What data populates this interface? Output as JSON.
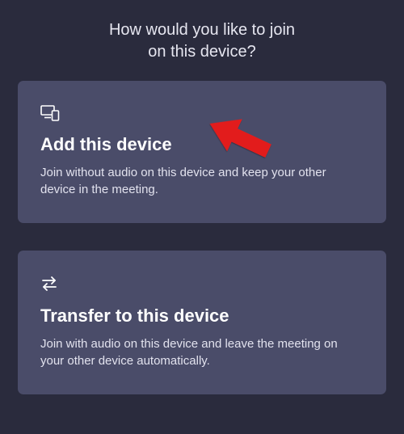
{
  "header": {
    "line1": "How would you like to join",
    "line2": "on this device?"
  },
  "cards": [
    {
      "icon": "devices-icon",
      "title": "Add this device",
      "desc": "Join without audio on this device and keep your other device in the meeting."
    },
    {
      "icon": "transfer-icon",
      "title": "Transfer to this device",
      "desc": "Join with audio on this device and leave the meeting on your other device automatically."
    }
  ],
  "annotation": {
    "color": "#e21b1b"
  }
}
